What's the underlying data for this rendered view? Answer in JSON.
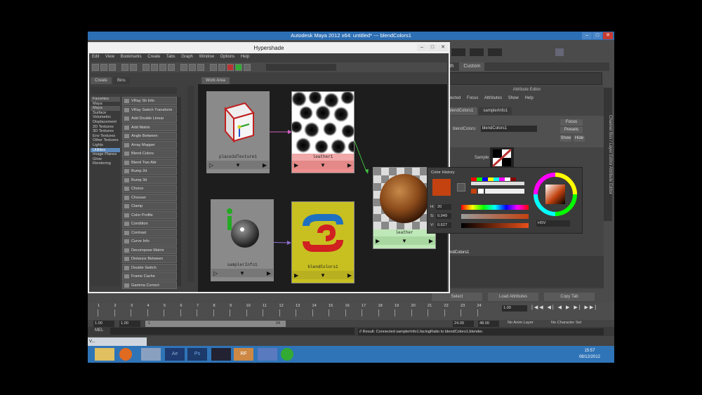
{
  "window": {
    "title": "Autodesk Maya 2012 x64: untitled*   ---   blendColors1",
    "controls": [
      "–",
      "□",
      "✕"
    ]
  },
  "hypershade": {
    "title": "Hypershade",
    "controls": [
      "–",
      "□",
      "✕"
    ],
    "menu": [
      "Edit",
      "View",
      "Bookmarks",
      "Create",
      "Tabs",
      "Graph",
      "Window",
      "Options",
      "Help"
    ],
    "left_tabs": [
      "Create",
      "Bins"
    ],
    "categories": [
      "Favorites",
      "Maya",
      "Maya",
      "Surface",
      "Volumetric",
      "Displacement",
      "2D Textures",
      "3D Textures",
      "Env Textures",
      "Other Textures",
      "Lights",
      "Utilities",
      "Image Planes",
      "Glow",
      "Rendering"
    ],
    "selected_category": "Utilities",
    "create_list": [
      "VRay Sh Info",
      "VRay Switch Transform",
      "Add Double Linear",
      "Add Matrix",
      "Angle Between",
      "Array Mapper",
      "Blend Colors",
      "Blend Two Attr",
      "Bump 2d",
      "Bump 3d",
      "Choice",
      "Chooser",
      "Clamp",
      "Color Profile",
      "Condition",
      "Contrast",
      "Curve Info",
      "Decompose Matrix",
      "Distance Between",
      "Double Switch",
      "Frame Cache",
      "Gamma Correct"
    ],
    "work_area_tab": "Work Area",
    "nodes": {
      "place3d": "place3dTexture1",
      "leather1": "leather1",
      "leather": "leather",
      "samplerInfo": "samplerInfo1",
      "blendColors": "blendColors1"
    }
  },
  "right_panel": {
    "tabs": [
      "lth",
      "Custom"
    ],
    "attribute_editor_title": "Attribute Editor",
    "ae_menu": [
      "Selected",
      "Focus",
      "Attributes",
      "Show",
      "Help"
    ],
    "ae_tabs": [
      "blendColors1",
      "samplerInfo1"
    ],
    "name_label": "blendColors:",
    "name_value": "blendColors1",
    "buttons": [
      "Focus",
      "Presets",
      "Show",
      "Hide"
    ],
    "sample_label": "Sample",
    "output_label": "blendColors1",
    "side_tabs": "Channel Box / Layer Editor   Attribute Editor"
  },
  "color_picker": {
    "title": "Color History",
    "h_label": "H:",
    "h_value": "20",
    "s_label": "S:",
    "s_value": "0,949",
    "v_label": "V:",
    "v_value": "0,627",
    "mode": "HSV",
    "current_color": "#c34210"
  },
  "bottom_buttons": [
    "Select",
    "Load Attributes",
    "Copy Tab"
  ],
  "timeline": {
    "ticks": [
      "1",
      "2",
      "3",
      "4",
      "5",
      "6",
      "7",
      "8",
      "9",
      "10",
      "11",
      "12",
      "13",
      "14",
      "15",
      "16",
      "17",
      "18",
      "19",
      "20",
      "21",
      "22",
      "23",
      "24"
    ],
    "current_frame": "1.00",
    "range_start": "1.00",
    "range_start2": "1.00",
    "range_inner_start": "1",
    "range_inner_end": "24",
    "range_end": "24.00",
    "range_end2": "48.00",
    "anim_layer": "No Anim Layer",
    "char_set": "No Character Set"
  },
  "command": {
    "label": "MEL",
    "result": "// Result: Connected samplerInfo1.facingRatio to blendColors1.blender."
  },
  "taskbar": {
    "maya_button": "V...",
    "time": "15:57",
    "date": "08/12/2012"
  }
}
